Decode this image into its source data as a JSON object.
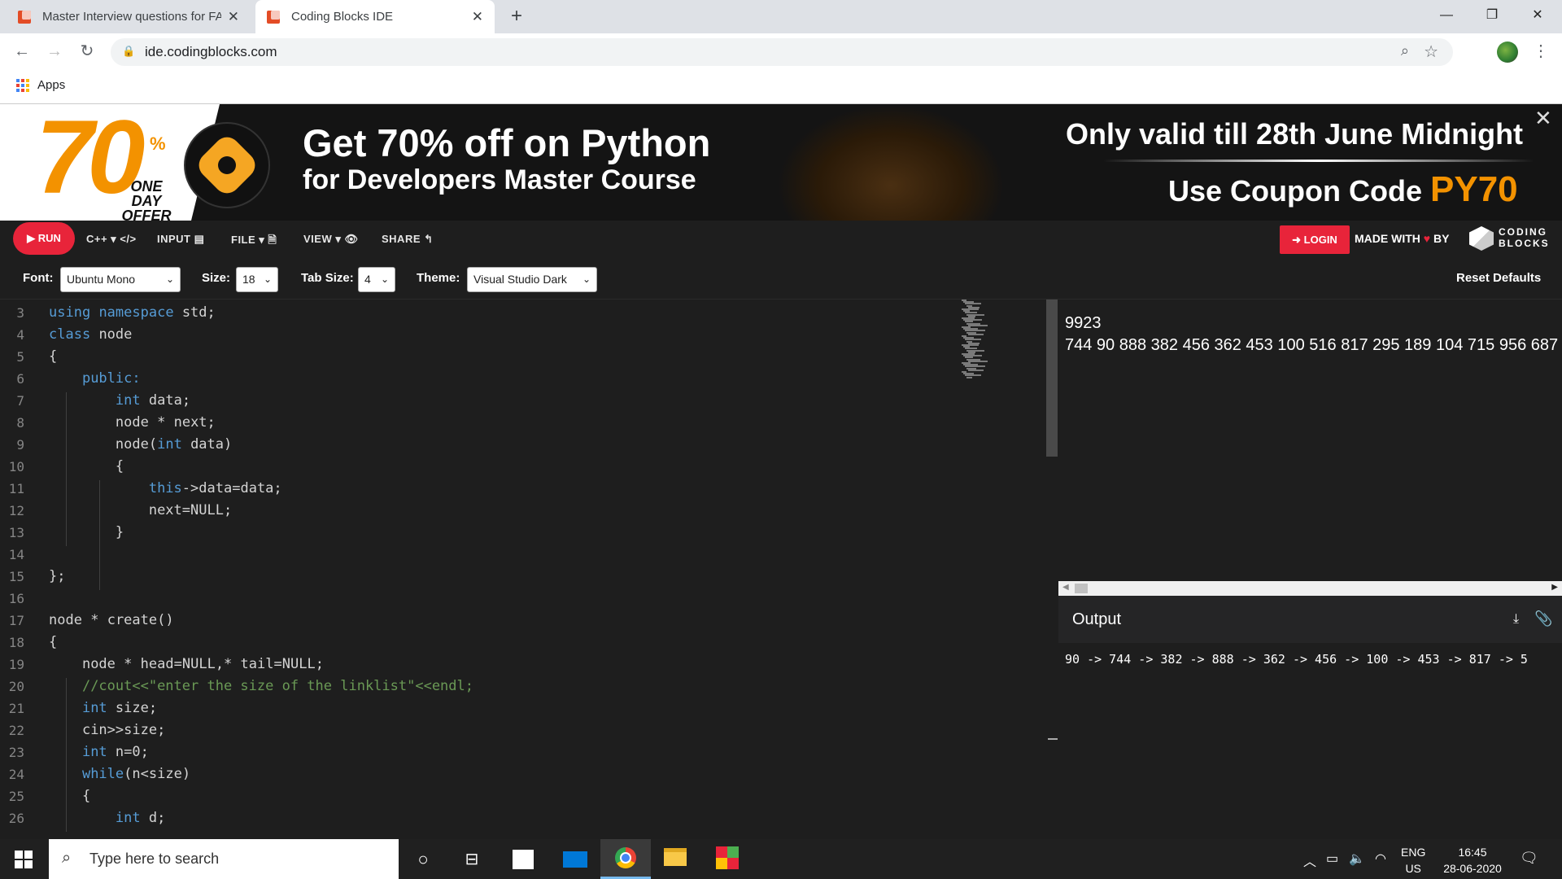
{
  "browser": {
    "tabs": [
      {
        "title": "Master Interview questions for FA"
      },
      {
        "title": "Coding Blocks IDE"
      }
    ],
    "new_tab": "+",
    "url": "ide.codingblocks.com",
    "bookmarks": {
      "apps": "Apps"
    },
    "window_controls": {
      "minimize": "—",
      "restore": "❐",
      "close": "✕"
    }
  },
  "banner": {
    "big_number": "70",
    "percent": "%",
    "offer": "ONE DAY OFFER",
    "title_line1": "Get 70% off on Python",
    "title_line2": "for Developers Master Course",
    "valid": "Only valid till 28th June Midnight",
    "coupon_prefix": "Use Coupon Code",
    "coupon_code": "PY70",
    "close": "✕"
  },
  "toolbar": {
    "run": "▶ RUN",
    "language": "C++ ▾ </>",
    "input": "INPUT ▤",
    "file": "FILE ▾ 🗎",
    "view": "VIEW ▾ 👁",
    "share": "SHARE ↰",
    "login": "➜ LOGIN",
    "made_with": "MADE WITH",
    "made_by": "BY",
    "heart": "♥",
    "brand_line1": "CODING",
    "brand_line2": "BLOCKS"
  },
  "settings": {
    "font_label": "Font:",
    "font_value": "Ubuntu Mono",
    "size_label": "Size:",
    "size_value": "18",
    "tab_label": "Tab Size:",
    "tab_value": "4",
    "theme_label": "Theme:",
    "theme_value": "Visual Studio Dark",
    "reset": "Reset Defaults"
  },
  "editor": {
    "lines": [
      {
        "n": "3",
        "t": "using namespace std;"
      },
      {
        "n": "4",
        "t": "class node"
      },
      {
        "n": "5",
        "t": "{"
      },
      {
        "n": "6",
        "t": "    public:"
      },
      {
        "n": "7",
        "t": "        int data;"
      },
      {
        "n": "8",
        "t": "        node * next;"
      },
      {
        "n": "9",
        "t": "        node(int data)"
      },
      {
        "n": "10",
        "t": "        {"
      },
      {
        "n": "11",
        "t": "            this->data=data;"
      },
      {
        "n": "12",
        "t": "            next=NULL;"
      },
      {
        "n": "13",
        "t": "        }"
      },
      {
        "n": "14",
        "t": ""
      },
      {
        "n": "15",
        "t": "};"
      },
      {
        "n": "16",
        "t": ""
      },
      {
        "n": "17",
        "t": "node * create()"
      },
      {
        "n": "18",
        "t": "{"
      },
      {
        "n": "19",
        "t": "    node * head=NULL,* tail=NULL;"
      },
      {
        "n": "20",
        "t": "    //cout<<\"enter the size of the linklist\"<<endl;"
      },
      {
        "n": "21",
        "t": "    int size;"
      },
      {
        "n": "22",
        "t": "    cin>>size;"
      },
      {
        "n": "23",
        "t": "    int n=0;"
      },
      {
        "n": "24",
        "t": "    while(n<size)"
      },
      {
        "n": "25",
        "t": "    {"
      },
      {
        "n": "26",
        "t": "        int d;"
      }
    ],
    "keywords": [
      "using",
      "namespace",
      "class",
      "public:",
      "int",
      "this",
      "while"
    ]
  },
  "input_pane": {
    "lines": [
      "9923",
      "744 90 888 382 456 362 453 100 516 817 295 189 104 715 956 687"
    ]
  },
  "output_pane": {
    "label": "Output",
    "download_icon": "⤓",
    "clip_icon": "📎",
    "text": "90 -> 744 -> 382 -> 888 -> 362 -> 456 -> 100 -> 453 -> 817 -> 5"
  },
  "taskbar": {
    "search_placeholder": "Type here to search",
    "lang_line1": "ENG",
    "lang_line2": "US",
    "time": "16:45",
    "date": "28-06-2020"
  }
}
